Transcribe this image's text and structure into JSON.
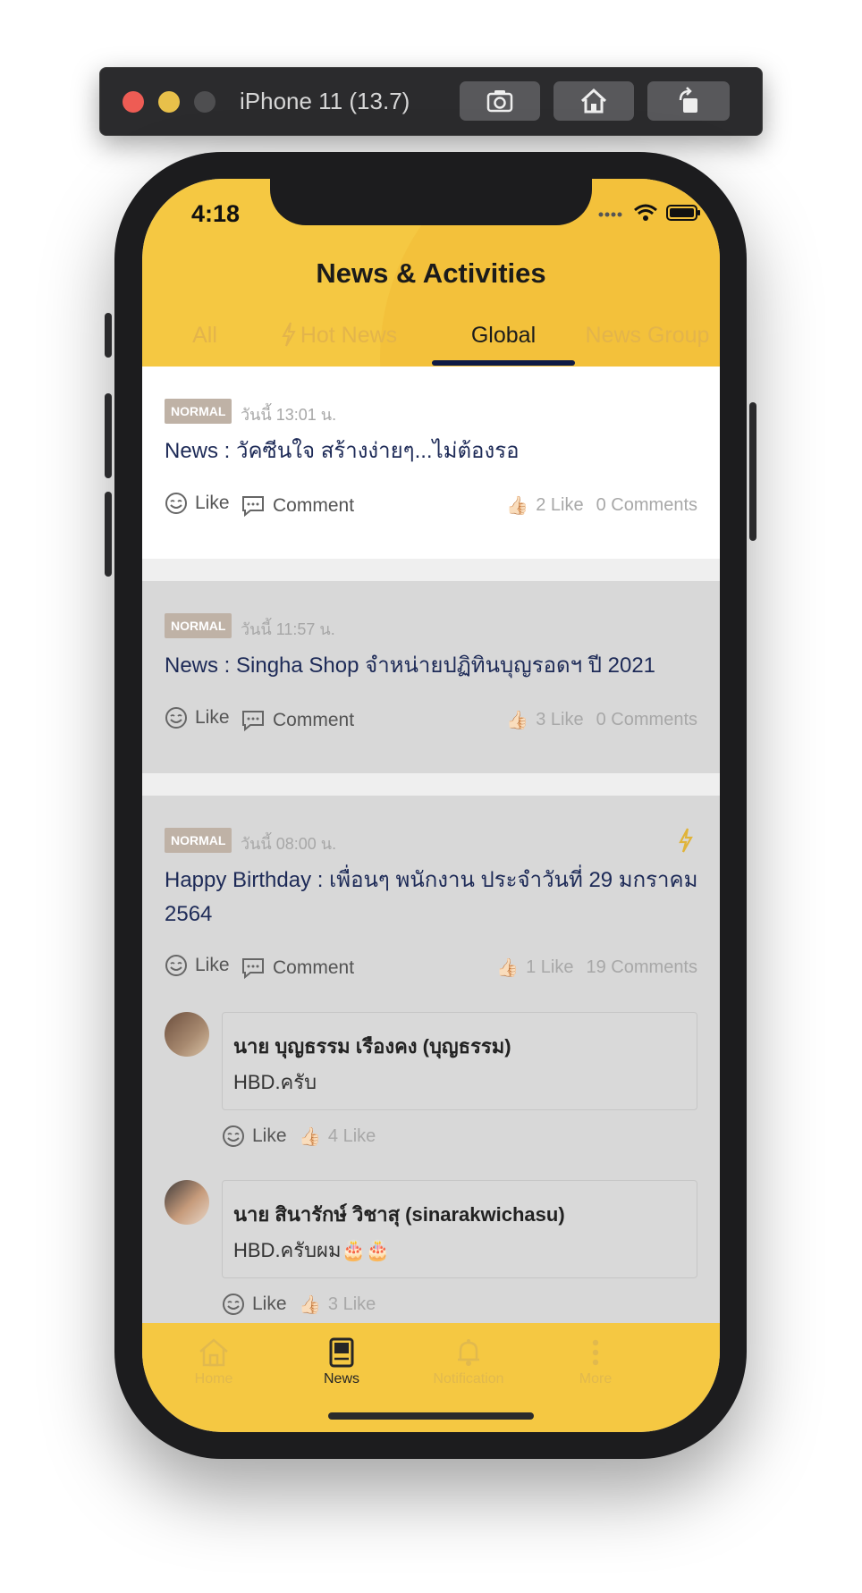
{
  "simulator": {
    "title": "iPhone 11 (13.7)"
  },
  "status_bar": {
    "time": "4:18"
  },
  "header": {
    "title": "News & Activities"
  },
  "tabs": [
    {
      "label": "All"
    },
    {
      "label": "Hot News"
    },
    {
      "label": "Global"
    },
    {
      "label": "News Group"
    }
  ],
  "active_tab": "Global",
  "posts": [
    {
      "badge": "NORMAL",
      "time": "วันนี้ 13:01 น.",
      "title": "News : วัคซีนใจ สร้างง่ายๆ...ไม่ต้องรอ",
      "like_label": "Like",
      "comment_label": "Comment",
      "like_count": "2 Like",
      "comment_count": "0 Comments"
    },
    {
      "badge": "NORMAL",
      "time": "วันนี้ 11:57 น.",
      "title": "News : Singha Shop จำหน่ายปฏิทินบุญรอดฯ ปี 2021",
      "like_label": "Like",
      "comment_label": "Comment",
      "like_count": "3 Like",
      "comment_count": "0 Comments"
    },
    {
      "badge": "NORMAL",
      "time": "วันนี้ 08:00 น.",
      "title": "Happy Birthday : เพื่อนๆ พนักงาน ประจำวันที่ 29 มกราคม 2564",
      "like_label": "Like",
      "comment_label": "Comment",
      "like_count": "1 Like",
      "comment_count": "19 Comments",
      "comments": [
        {
          "name": "นาย บุญธรรม เรืองคง (บุญธรรม)",
          "text": "HBD.ครับ",
          "like_label": "Like",
          "like_count": "4 Like"
        },
        {
          "name": "นาย สินารักษ์ วิชาสุ (sinarakwichasu)",
          "text": "HBD.ครับผม🎂🎂",
          "like_label": "Like",
          "like_count": "3 Like"
        }
      ]
    }
  ],
  "tabbar": [
    {
      "label": "Home",
      "icon": "home-icon"
    },
    {
      "label": "News",
      "icon": "news-icon"
    },
    {
      "label": "Notification",
      "icon": "bell-icon"
    },
    {
      "label": "More",
      "icon": "more-icon"
    }
  ],
  "colors": {
    "header_bg": "#f5c842",
    "tab_underline": "#0e1a44",
    "badge_bg": "#bfb2a6",
    "title_text": "#1d2a57"
  }
}
